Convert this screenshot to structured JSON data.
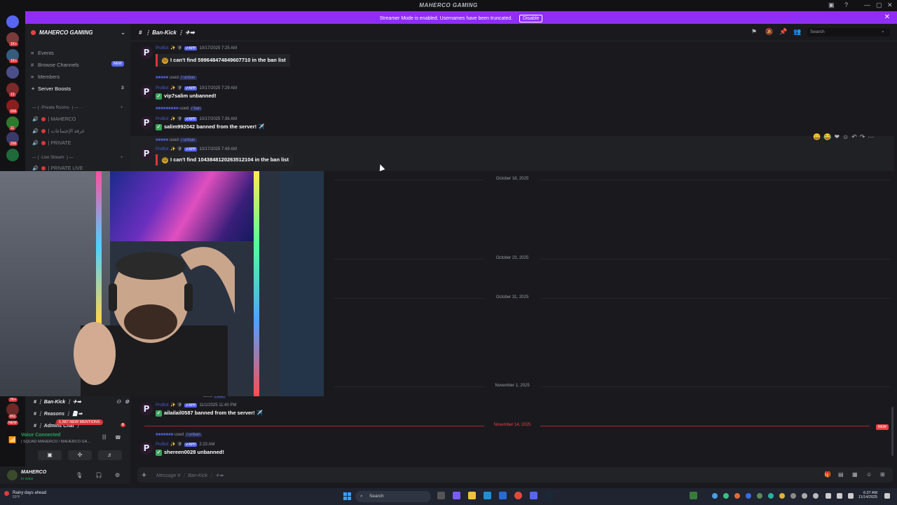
{
  "window": {
    "title": "MAHERCO GAMING",
    "controls": [
      "—",
      "▢",
      "✕"
    ]
  },
  "streamer_bar": {
    "message": "Streamer Mode is enabled. Usernames have been truncated.",
    "disable_label": "Disable",
    "close": "✕"
  },
  "server_rail": {
    "badges": [
      "1K+",
      "1K+",
      "13",
      "666",
      "11",
      "6",
      "266"
    ],
    "lower_badges": [
      "7K+",
      "851",
      "NEW"
    ]
  },
  "sidebar": {
    "server_name": "MAHERCO GAMING",
    "items": [
      {
        "icon": "≡",
        "label": "Events"
      },
      {
        "icon": "#",
        "label": "Browse Channels",
        "badge": "NEW"
      },
      {
        "icon": "≡",
        "label": "Members"
      },
      {
        "icon": "✦",
        "label": "Server Boosts",
        "count": "3"
      }
    ],
    "category_private": "— ( ·Private Rooms· ) — · ·",
    "voice_channels": [
      "| MAHERCO",
      "| غرفة الإجتماعات",
      "| PRIVATE"
    ],
    "category_live": "— ( ·Live Stream· ) —",
    "voice_live": "| PRIVATE LIVE"
  },
  "header": {
    "channel": "⋮ Ban-Kick ⋮ ✈➡",
    "search_placeholder": "Search"
  },
  "messages": [
    {
      "meta_author": "ProBot",
      "app": "✔APP",
      "time": "10/17/2025 7:25 AM",
      "body": "I can't find 599648474849607710 in the ban list",
      "emoji": "☹",
      "type": "quote"
    },
    {
      "reply": "used",
      "cmd": "/ unban",
      "meta_author": "ProBot",
      "app": "✔APP",
      "time": "10/17/2025 7:29 AM",
      "body": "vip7salim unbanned!",
      "emoji": "✓"
    },
    {
      "reply": "used",
      "cmd": "/ ban",
      "meta_author": "ProBot",
      "app": "✔APP",
      "time": "10/17/2025 7:36 AM",
      "body": "salim992042 banned from the server! ✈️",
      "emoji": "✓"
    },
    {
      "reply": "used",
      "cmd": "/ unban",
      "meta_author": "ProBot",
      "app": "✔APP",
      "time": "10/17/2025 7:49 AM",
      "body": "I can't find 1043848120263512104 in the ban list",
      "emoji": "☹",
      "type": "quote"
    },
    {
      "reply": "used",
      "cmd": "/ ban",
      "meta_author": "ProBot",
      "app": "✔APP",
      "time": "11/1/2025 11:40 PM",
      "body": "ailailail0587 banned from the server! ✈️",
      "emoji": "✓"
    },
    {
      "reply": "used",
      "cmd": "/ unban",
      "meta_author": "ProBot",
      "app": "✔APP",
      "time": "2:23 AM",
      "body": "shereen0028 unbanned!",
      "emoji": "✓"
    }
  ],
  "date_separators": [
    "October 18, 2025",
    "October 23, 2025",
    "October 31, 2025",
    "November 1, 2025",
    "November 14, 2025"
  ],
  "new_tag": "NEW",
  "channel_panel": {
    "ban_kick": "⋮ Ban-Kick ⋮ ✈➡",
    "reasons": "⋮ Reasons ⋮ 📄➡",
    "admins": "⋮ Admins Chat ⋮",
    "mentions": "1,587 NEW MENTIONS",
    "mention_count": "6"
  },
  "voice": {
    "status": "Voice Connected",
    "channel": "| SQUAD MAHERCO / MAHERCO GA..."
  },
  "account": {
    "name": "MAHERCO",
    "status": "In voice"
  },
  "composer": {
    "placeholder": "Message # ⋮ Ban-Kick ⋮ ✈➡"
  },
  "taskbar": {
    "weather": "Rainy days ahead",
    "temp": "53°F",
    "search": "Search",
    "time": "6:37 AM",
    "date": "11/14/2025"
  },
  "colors": {
    "accent": "#8f2df7",
    "danger": "#f23f43",
    "blurple": "#5865f2",
    "online": "#23a55a"
  }
}
